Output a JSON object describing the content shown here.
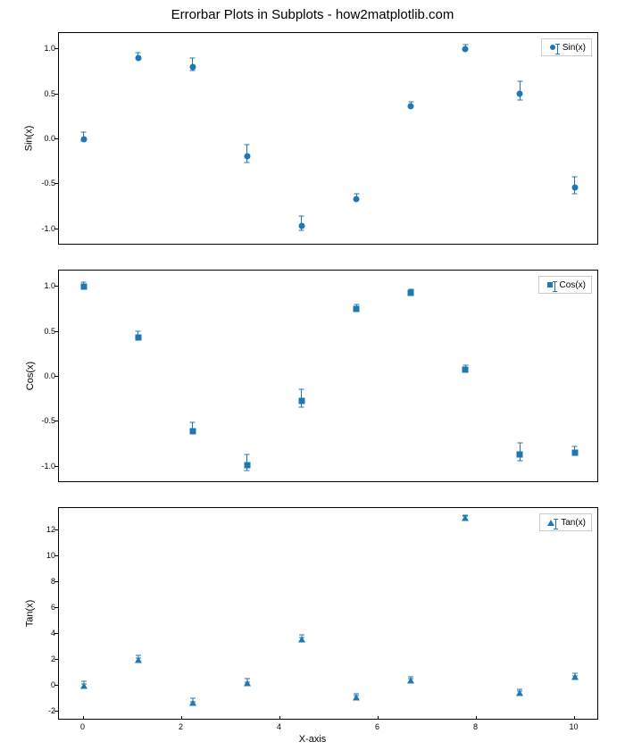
{
  "title": "Errorbar Plots in Subplots - how2matplotlib.com",
  "xlabel": "X-axis",
  "color": "#1f77b4",
  "chart_data": [
    {
      "type": "scatter",
      "name": "Sin(x)",
      "ylabel": "Sin(x)",
      "marker": "circle",
      "xlim": [
        -0.5,
        10.5
      ],
      "ylim": [
        -1.18,
        1.18
      ],
      "yticks": [
        -1.0,
        -0.5,
        0.0,
        0.5,
        1.0
      ],
      "xticks": [
        0,
        2,
        4,
        6,
        8,
        10
      ],
      "x": [
        0.0,
        1.11,
        2.22,
        3.33,
        4.44,
        5.56,
        6.67,
        7.78,
        8.89,
        10.0
      ],
      "y": [
        0.0,
        0.9,
        0.8,
        -0.19,
        -0.96,
        -0.66,
        0.37,
        1.0,
        0.51,
        -0.54
      ],
      "yerr": [
        0.05,
        0.03,
        0.07,
        0.1,
        0.08,
        0.03,
        0.02,
        0.02,
        0.1,
        0.09
      ]
    },
    {
      "type": "scatter",
      "name": "Cos(x)",
      "ylabel": "Cos(x)",
      "marker": "square",
      "xlim": [
        -0.5,
        10.5
      ],
      "ylim": [
        -1.18,
        1.18
      ],
      "yticks": [
        -1.0,
        -0.5,
        0.0,
        0.5,
        1.0
      ],
      "xticks": [
        0,
        2,
        4,
        6,
        8,
        10
      ],
      "x": [
        0.0,
        1.11,
        2.22,
        3.33,
        4.44,
        5.56,
        6.67,
        7.78,
        8.89,
        10.0
      ],
      "y": [
        1.0,
        0.44,
        -0.6,
        -0.98,
        -0.27,
        0.75,
        0.93,
        0.08,
        -0.86,
        -0.84
      ],
      "yerr": [
        0.02,
        0.04,
        0.06,
        0.09,
        0.1,
        0.02,
        0.01,
        0.02,
        0.1,
        0.04
      ]
    },
    {
      "type": "scatter",
      "name": "Tan(x)",
      "ylabel": "Tan(x)",
      "marker": "triangle",
      "xlim": [
        -0.5,
        10.5
      ],
      "ylim": [
        -2.7,
        13.7
      ],
      "yticks": [
        -2,
        0,
        2,
        4,
        6,
        8,
        10,
        12
      ],
      "xticks": [
        0,
        2,
        4,
        6,
        8,
        10
      ],
      "x": [
        0.0,
        1.11,
        2.22,
        3.33,
        4.44,
        5.56,
        6.67,
        7.78,
        8.89,
        10.0
      ],
      "y": [
        0.0,
        2.02,
        -1.32,
        0.2,
        3.58,
        -0.89,
        0.4,
        12.91,
        -0.59,
        0.65
      ],
      "yerr": [
        0.1,
        0.08,
        0.15,
        0.14,
        0.1,
        0.06,
        0.09,
        0.05,
        0.07,
        0.13
      ]
    }
  ],
  "layout": {
    "subplot_tops": [
      36,
      302,
      568
    ],
    "subplot_height": 238,
    "x_axis_row_top": 806
  }
}
